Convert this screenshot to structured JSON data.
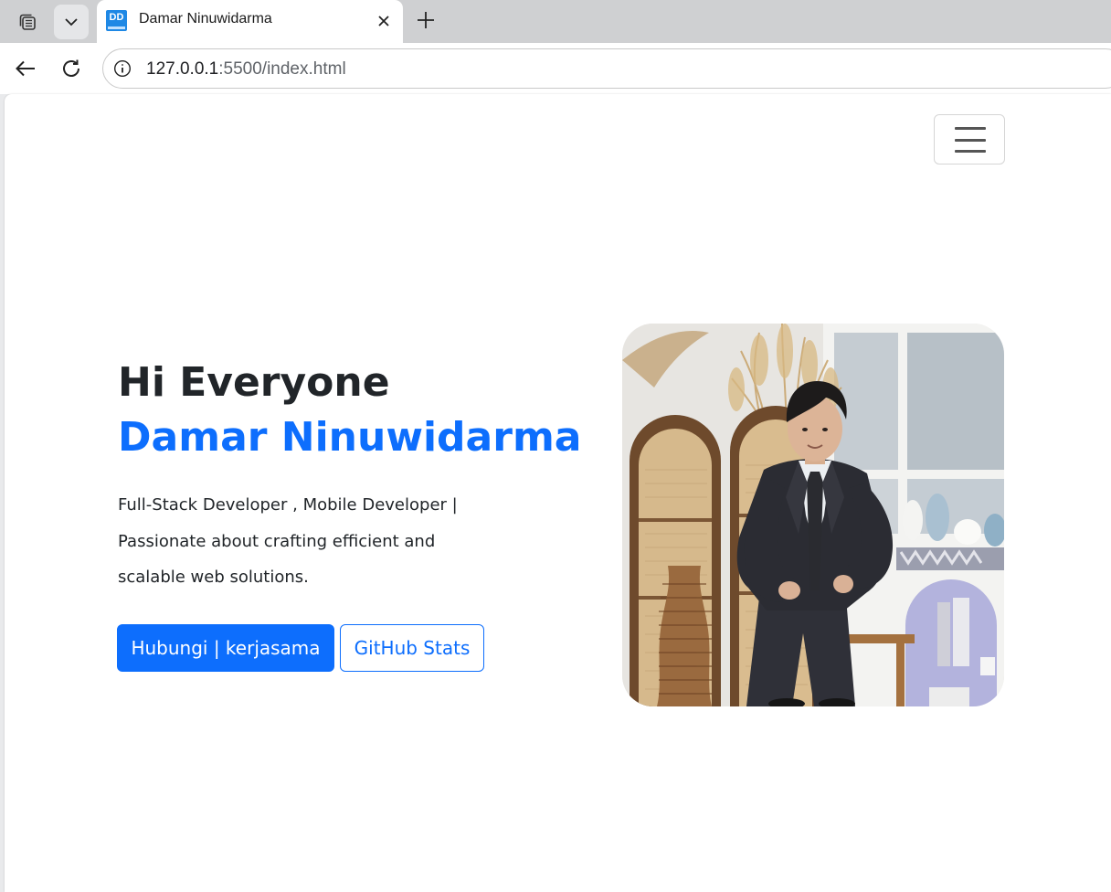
{
  "browser": {
    "tab": {
      "favicon_text": "DD",
      "title": "Damar Ninuwidarma"
    },
    "address": {
      "host": "127.0.0.1",
      "path": ":5500/index.html"
    },
    "icons": {
      "workspaces": "workspaces-icon",
      "tab_list": "chevron-down-icon",
      "close_tab": "close-icon",
      "new_tab": "plus-icon",
      "back": "back-arrow-icon",
      "reload": "reload-icon",
      "site_info": "info-icon"
    }
  },
  "page": {
    "nav": {
      "toggler_icon": "hamburger-menu-icon"
    },
    "hero": {
      "greeting": "Hi Everyone",
      "name": "Damar Ninuwidarma",
      "description": "Full-Stack Developer , Mobile Developer | Passionate about crafting efficient and scalable web solutions.",
      "primary_button": "Hubungi | kerjasama",
      "secondary_button": "GitHub Stats"
    },
    "colors": {
      "primary": "#0d6efd",
      "heading": "#212529"
    }
  }
}
